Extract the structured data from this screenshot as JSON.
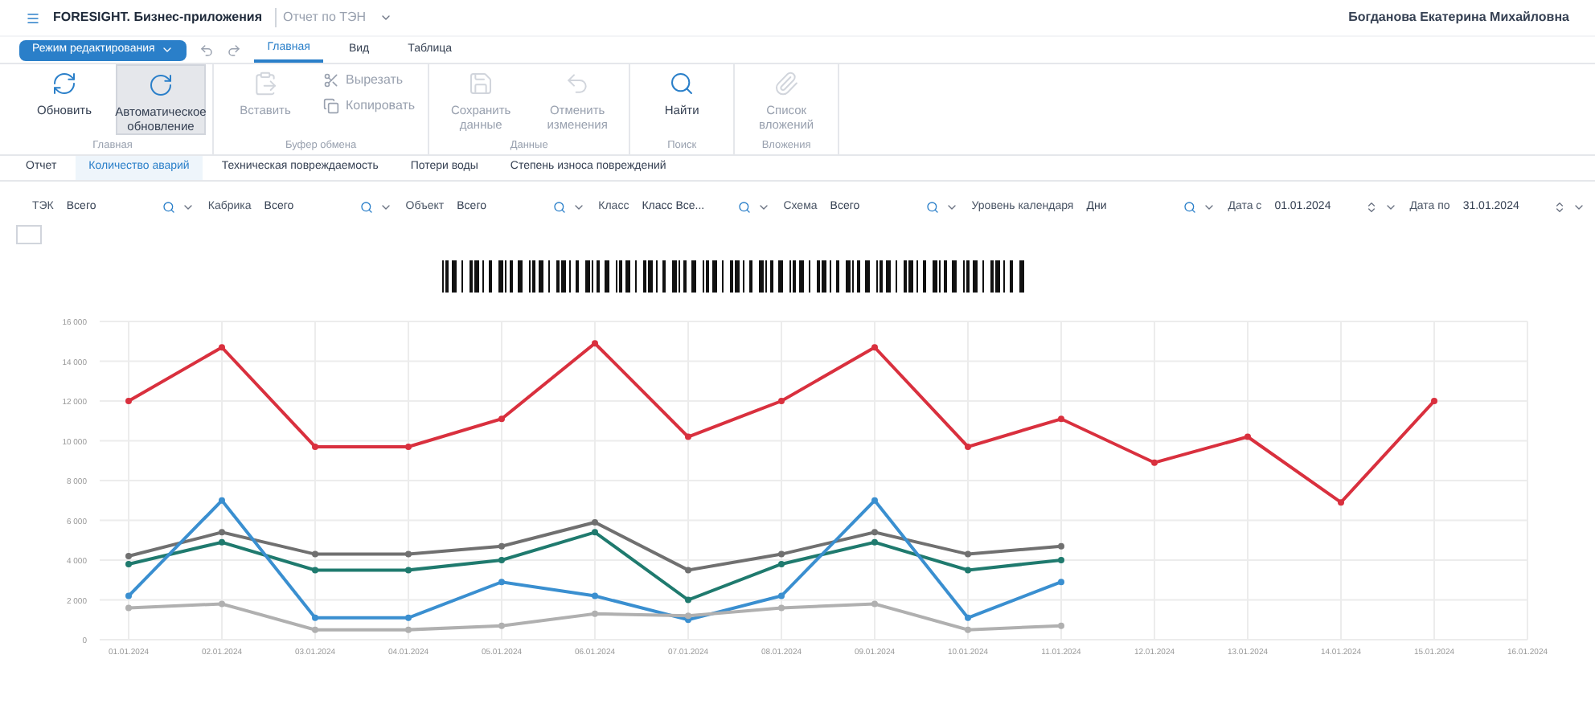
{
  "app_title": "FORESIGHT. Бизнес-приложения",
  "doc_title": "Отчет по ТЭН",
  "user": "Богданова Екатерина Михайловна",
  "mode_button": "Режим редактирования",
  "tabs": [
    {
      "label": "Главная",
      "selected": true
    },
    {
      "label": "Вид",
      "selected": false
    },
    {
      "label": "Таблица",
      "selected": false
    }
  ],
  "ribbon_groups": [
    {
      "label": "Главная",
      "items": [
        {
          "kind": "big",
          "label": "Обновить",
          "pressed": false
        },
        {
          "kind": "big",
          "label": "Автоматическое обновление",
          "pressed": true
        }
      ]
    },
    {
      "label": "Буфер обмена",
      "items": [
        {
          "kind": "big",
          "label": "Вставить",
          "pressed": false
        },
        {
          "kind": "small",
          "label": "Вырезать",
          "pressed": false
        },
        {
          "kind": "small",
          "label": "Копировать",
          "pressed": false
        }
      ]
    },
    {
      "label": "Данные",
      "items": [
        {
          "kind": "big",
          "label": "Сохранить данные",
          "pressed": false
        },
        {
          "kind": "big",
          "label": "Отменить изменения",
          "pressed": false
        }
      ]
    },
    {
      "label": "Поиск",
      "items": [
        {
          "kind": "big",
          "label": "Найти",
          "pressed": false
        }
      ]
    },
    {
      "label": "Вложения",
      "items": [
        {
          "kind": "big",
          "label": "Список вложений",
          "pressed": false
        }
      ]
    }
  ],
  "sheets": [
    {
      "label": "Отчет",
      "selected": false
    },
    {
      "label": "Количество аварий",
      "selected": true
    },
    {
      "label": "Техническая повреждаемость",
      "selected": false
    },
    {
      "label": "Потери воды",
      "selected": false
    },
    {
      "label": "Степень износа повреждений",
      "selected": false
    }
  ],
  "filters": [
    {
      "kind": "lookup",
      "label": "ТЭК",
      "value": "Всего"
    },
    {
      "kind": "lookup",
      "label": "Кабрика",
      "value": "Всего"
    },
    {
      "kind": "lookup",
      "label": "Объект",
      "value": "Всего"
    },
    {
      "kind": "lookup",
      "label": "Класс",
      "value": "Класс Все..."
    },
    {
      "kind": "lookup",
      "label": "Схема",
      "value": "Всего"
    },
    {
      "kind": "lookup",
      "label": "Уровень календаря",
      "value": "Дни"
    },
    {
      "kind": "date",
      "label": "Дата с",
      "value": "01.01.2024"
    },
    {
      "kind": "date",
      "label": "Дата по",
      "value": "31.01.2024"
    }
  ],
  "legend_toggle": {
    "checked": false
  },
  "chart_data": {
    "type": "line",
    "grid": true,
    "categories": [
      "01.01.2024",
      "02.01.2024",
      "03.01.2024",
      "04.01.2024",
      "05.01.2024",
      "06.01.2024",
      "07.01.2024",
      "08.01.2024",
      "09.01.2024",
      "10.01.2024",
      "11.01.2024",
      "12.01.2024",
      "13.01.2024",
      "14.01.2024",
      "15.01.2024",
      "16.01.2024"
    ],
    "ylim": [
      0,
      16000
    ],
    "yticks": [
      {
        "value": 0,
        "label": "0"
      },
      {
        "value": 2000,
        "label": "2 000"
      },
      {
        "value": 4000,
        "label": "4 000"
      },
      {
        "value": 6000,
        "label": "6 000"
      },
      {
        "value": 8000,
        "label": "8 000"
      },
      {
        "value": 10000,
        "label": "10 000"
      },
      {
        "value": 12000,
        "label": "12 000"
      },
      {
        "value": 14000,
        "label": "14 000"
      },
      {
        "value": 16000,
        "label": "16 000"
      }
    ],
    "series": [
      {
        "color": "#d9303e",
        "marker": true,
        "values": [
          12000,
          14700,
          9700,
          9700,
          11100,
          14900,
          10200,
          12000,
          14700,
          9700,
          11100,
          8900,
          10200,
          6900,
          12000,
          null
        ]
      },
      {
        "color": "#707070",
        "marker": true,
        "values": [
          4200,
          5400,
          4300,
          4300,
          4700,
          5900,
          3500,
          4300,
          5400,
          4300,
          4700,
          null,
          null,
          null,
          null,
          null
        ]
      },
      {
        "color": "#1f7a6e",
        "marker": true,
        "values": [
          3800,
          4900,
          3500,
          3500,
          4000,
          5400,
          2000,
          3800,
          4900,
          3500,
          4000,
          null,
          null,
          null,
          null,
          null
        ]
      },
      {
        "color": "#3a8fd0",
        "marker": true,
        "values": [
          2200,
          7000,
          1100,
          1100,
          2900,
          2200,
          1000,
          2200,
          7000,
          1100,
          2900,
          null,
          null,
          null,
          null,
          null
        ]
      },
      {
        "color": "#b0b0b0",
        "marker": true,
        "values": [
          1600,
          1800,
          500,
          500,
          700,
          1300,
          1200,
          1600,
          1800,
          500,
          700,
          null,
          null,
          null,
          null,
          null
        ]
      }
    ]
  }
}
